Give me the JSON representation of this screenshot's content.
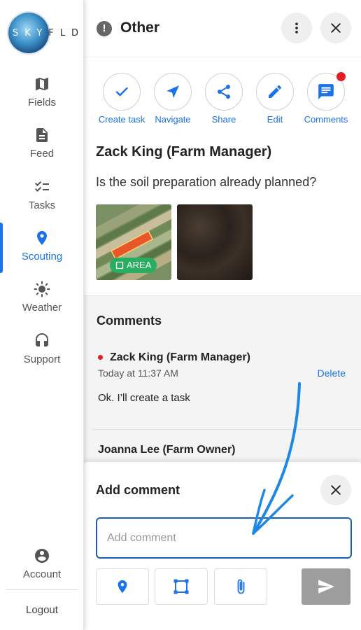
{
  "brand": {
    "logo_text_light": "SKY",
    "logo_text_dark": "FLD"
  },
  "sidebar": {
    "items": [
      {
        "label": "Fields",
        "icon": "map-icon"
      },
      {
        "label": "Feed",
        "icon": "feed-icon"
      },
      {
        "label": "Tasks",
        "icon": "tasks-icon"
      },
      {
        "label": "Scouting",
        "icon": "location-pin-icon",
        "active": true
      },
      {
        "label": "Weather",
        "icon": "sun-icon"
      },
      {
        "label": "Support",
        "icon": "headset-icon"
      }
    ],
    "account_label": "Account",
    "logout_label": "Logout"
  },
  "header": {
    "title": "Other",
    "info_icon_glyph": "!"
  },
  "actions": [
    {
      "label": "Create task",
      "icon": "check-icon"
    },
    {
      "label": "Navigate",
      "icon": "navigate-arrow-icon"
    },
    {
      "label": "Share",
      "icon": "share-icon"
    },
    {
      "label": "Edit",
      "icon": "pencil-icon"
    },
    {
      "label": "Comments",
      "icon": "comment-bubble-icon",
      "has_notification": true
    }
  ],
  "post": {
    "author": "Zack King (Farm Manager)",
    "question": "Is the soil preparation already planned?",
    "area_badge": "AREA"
  },
  "comments": {
    "title": "Comments",
    "items": [
      {
        "author": "Zack King (Farm Manager)",
        "time": "Today at 11:37 AM",
        "text": "Ok. I’ll create a task",
        "delete_label": "Delete",
        "unread": true
      },
      {
        "author": "Joanna Lee (Farm Owner)"
      }
    ]
  },
  "add_comment": {
    "title": "Add comment",
    "placeholder": "Add comment",
    "value": ""
  },
  "colors": {
    "accent": "#1a73e8",
    "notification": "#e51c23",
    "area_badge": "#27ae60",
    "send_disabled": "#9e9e9e"
  }
}
